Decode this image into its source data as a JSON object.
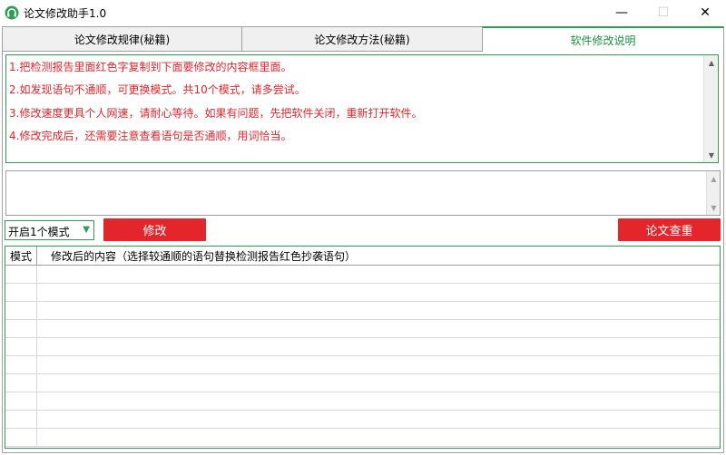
{
  "window": {
    "title": "论文修改助手1.0",
    "minimize_glyph": "—",
    "maximize_glyph": "☐",
    "close_glyph": "✕"
  },
  "tabs": [
    {
      "label": "论文修改规律(秘籍)"
    },
    {
      "label": "论文修改方法(秘籍)"
    },
    {
      "label": "软件修改说明",
      "active": true
    }
  ],
  "instructions": [
    "1.把检测报告里面红色字复制到下面要修改的内容框里面。",
    "2.如发现语句不通顺，可更换模式。共10个模式，请多尝试。",
    "3.修改速度更具个人网速，请耐心等待。如果有问题，先把软件关闭，重新打开软件。",
    "4.修改完成后，还需要注意查看语句是否通顺，用词恰当。"
  ],
  "input": {
    "value": ""
  },
  "mode_select": {
    "selected": "开启1个模式",
    "caret": "▼"
  },
  "buttons": {
    "modify": "修改",
    "check": "论文查重"
  },
  "grid": {
    "columns": [
      "模式",
      "修改后的内容（选择较通顺的语句替换检测报告红色抄袭语句）"
    ],
    "rows": []
  },
  "colors": {
    "accent": "#2e9e54",
    "danger": "#e3262b"
  },
  "icons": {
    "app": "headphones-icon"
  }
}
